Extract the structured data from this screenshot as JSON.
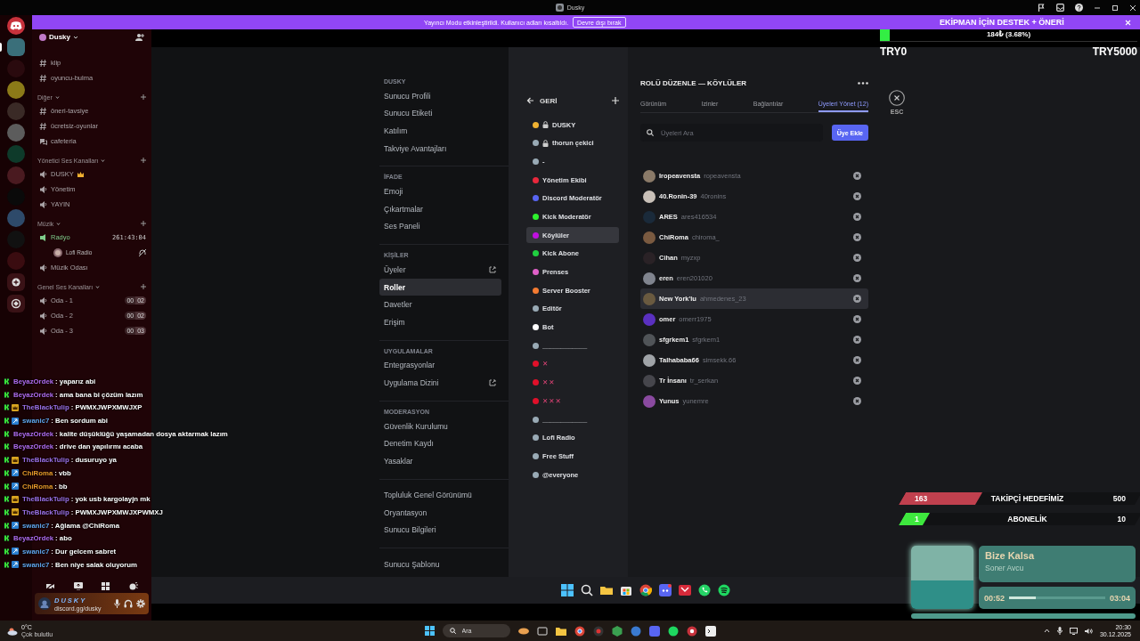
{
  "window": {
    "title": "Dusky"
  },
  "banner": {
    "message": "Yayıncı Modu etkinleştirildi. Kullanıcı adları kısaltıldı.",
    "button": "Devre dışı bırak",
    "promo": "EKİPMAN İÇİN DESTEK + ÖNERİ"
  },
  "rail": {
    "servers": [
      {
        "selected": true
      },
      {
        "selected": false
      },
      {
        "selected": false
      },
      {
        "selected": false
      },
      {
        "selected": false
      },
      {
        "selected": false
      },
      {
        "selected": false
      },
      {
        "selected": false
      },
      {
        "selected": false
      },
      {
        "selected": false
      },
      {
        "selected": false
      }
    ]
  },
  "server": {
    "name": "Dusky"
  },
  "channels": [
    {
      "kind": "text",
      "name": "klip"
    },
    {
      "kind": "text",
      "name": "oyuncu-bulma"
    },
    {
      "kind": "category",
      "name": "Diğer"
    },
    {
      "kind": "text",
      "name": "öneri-tavsiye"
    },
    {
      "kind": "text",
      "name": "ücretsiz-oyunlar"
    },
    {
      "kind": "forum",
      "name": "cafeteria"
    },
    {
      "kind": "category",
      "name": "Yönetici Ses Kanalları"
    },
    {
      "kind": "voice",
      "name": "DUSKY"
    },
    {
      "kind": "voice",
      "name": "Yönetim"
    },
    {
      "kind": "voice",
      "name": "YAYIN"
    },
    {
      "kind": "category",
      "name": "Müzik"
    },
    {
      "kind": "stage",
      "name": "Radyo",
      "time": "261:43:04"
    },
    {
      "kind": "member",
      "name": "Lofi Radio"
    },
    {
      "kind": "voice",
      "name": "Müzik Odası"
    },
    {
      "kind": "category",
      "name": "Genel Ses Kanalları"
    },
    {
      "kind": "voice",
      "name": "Oda - 1",
      "count": "00",
      "limit": "02"
    },
    {
      "kind": "voice",
      "name": "Oda - 2",
      "count": "00",
      "limit": "02"
    },
    {
      "kind": "voice",
      "name": "Oda - 3",
      "count": "00",
      "limit": "03"
    }
  ],
  "user_panel": {
    "name": "DUSKY",
    "status": "discord.gg/dusky"
  },
  "chat": [
    {
      "kind": "plain",
      "user": "BeyazOrdek",
      "color": "#b06cf0",
      "text": ": yaparız abi"
    },
    {
      "kind": "plain",
      "user": "BeyazOrdek",
      "color": "#b06cf0",
      "text": ": ama bana bi çözüm lazım"
    },
    {
      "kind": "crown",
      "user": "TheBlackTulip",
      "color": "#9d72ea",
      "text": ": PWMXJWPXMWJXP"
    },
    {
      "kind": "square",
      "user": "swanic7",
      "color": "#62a6ee",
      "text": ": Ben sordum abi"
    },
    {
      "kind": "plain",
      "user": "BeyazOrdek",
      "color": "#b06cf0",
      "text": ": kalite düşüklüğü yaşamadan dosya aktarmak lazım"
    },
    {
      "kind": "plain",
      "user": "BeyazOrdek",
      "color": "#b06cf0",
      "text": ": drive dan yapılırmı acaba"
    },
    {
      "kind": "crown",
      "user": "TheBlackTulip",
      "color": "#9d72ea",
      "text": ": dusuruyo ya"
    },
    {
      "kind": "square",
      "user": "ChiRoma",
      "color": "#e89a2a",
      "text": ": vbb"
    },
    {
      "kind": "square",
      "user": "ChiRoma",
      "color": "#e89a2a",
      "text": ": bb"
    },
    {
      "kind": "crown",
      "user": "TheBlackTulip",
      "color": "#9d72ea",
      "text": ": yok usb kargolayjn mk"
    },
    {
      "kind": "crown",
      "user": "TheBlackTulip",
      "color": "#9d72ea",
      "text": ": PWMXJWPXMWJXPWMXJ"
    },
    {
      "kind": "square",
      "user": "swanic7",
      "color": "#62a6ee",
      "text": ": Ağlama @ChiRoma"
    },
    {
      "kind": "plain",
      "user": "BeyazOrdek",
      "color": "#b06cf0",
      "text": ": abo"
    },
    {
      "kind": "square",
      "user": "swanic7",
      "color": "#62a6ee",
      "text": ": Dur gelcem sabret"
    },
    {
      "kind": "square",
      "user": "swanic7",
      "color": "#62a6ee",
      "text": ": Ben niye salak oluyorum"
    }
  ],
  "settings_nav": [
    {
      "title": "DUSKY",
      "items": [
        {
          "label": "Sunucu Profili",
          "selected": false,
          "external": false
        },
        {
          "label": "Sunucu Etiketi",
          "selected": false,
          "external": false
        },
        {
          "label": "Katılım",
          "selected": false,
          "external": false
        },
        {
          "label": "Takviye Avantajları",
          "selected": false,
          "external": false
        }
      ]
    },
    {
      "title": "İFADE",
      "items": [
        {
          "label": "Emoji",
          "selected": false,
          "external": false
        },
        {
          "label": "Çıkartmalar",
          "selected": false,
          "external": false
        },
        {
          "label": "Ses Paneli",
          "selected": false,
          "external": false
        }
      ]
    },
    {
      "title": "KİŞİLER",
      "items": [
        {
          "label": "Üyeler",
          "selected": false,
          "external": true
        },
        {
          "label": "Roller",
          "selected": true,
          "external": false
        },
        {
          "label": "Davetler",
          "selected": false,
          "external": false
        },
        {
          "label": "Erişim",
          "selected": false,
          "external": false
        }
      ]
    },
    {
      "title": "UYGULAMALAR",
      "items": [
        {
          "label": "Entegrasyonlar",
          "selected": false,
          "external": false
        },
        {
          "label": "Uygulama Dizini",
          "selected": false,
          "external": true
        }
      ]
    },
    {
      "title": "MODERASYON",
      "items": [
        {
          "label": "Güvenlik Kurulumu",
          "selected": false,
          "external": false
        },
        {
          "label": "Denetim Kaydı",
          "selected": false,
          "external": false
        },
        {
          "label": "Yasaklar",
          "selected": false,
          "external": false
        }
      ]
    },
    {
      "items": [
        {
          "label": "Topluluk Genel Görünümü",
          "selected": false,
          "external": false
        },
        {
          "label": "Oryantasyon",
          "selected": false,
          "external": false
        },
        {
          "label": "Sunucu Bilgileri",
          "selected": false,
          "external": false
        }
      ]
    },
    {
      "items": [
        {
          "label": "Sunucu Şablonu",
          "selected": false,
          "external": false
        }
      ]
    }
  ],
  "roles": {
    "back": "GERİ",
    "items": [
      {
        "kind": "name",
        "name": "DUSKY",
        "color": "#f0b232",
        "locked": true,
        "selected": false
      },
      {
        "kind": "name",
        "name": "thorun çekici",
        "color": "#99aab5",
        "locked": true,
        "selected": false
      },
      {
        "kind": "name",
        "name": "-",
        "color": "#99aab5",
        "locked": false,
        "selected": false
      },
      {
        "kind": "name",
        "name": "Yönetim Ekibi",
        "color": "#e8283c",
        "locked": false,
        "selected": false
      },
      {
        "kind": "name",
        "name": "Discord Moderatör",
        "color": "#5865f2",
        "locked": false,
        "selected": false
      },
      {
        "kind": "name",
        "name": "Kick Moderatör",
        "color": "#2ef02e",
        "locked": false,
        "selected": false
      },
      {
        "kind": "name",
        "name": "Köylüler",
        "color": "#c010e0",
        "locked": false,
        "selected": true
      },
      {
        "kind": "name",
        "name": "Kick Abone",
        "color": "#20d040",
        "locked": false,
        "selected": false
      },
      {
        "kind": "name",
        "name": "Prenses",
        "color": "#e060c8",
        "locked": false,
        "selected": false
      },
      {
        "kind": "name",
        "name": "Server Booster",
        "color": "#f47b32",
        "locked": false,
        "selected": false
      },
      {
        "kind": "name",
        "name": "Editör",
        "color": "#99aab5",
        "locked": false,
        "selected": false
      },
      {
        "kind": "name",
        "name": "Bot",
        "color": "#ffffff",
        "locked": false,
        "selected": false
      },
      {
        "kind": "name",
        "name": "____________",
        "color": "#99aab5",
        "locked": false,
        "selected": false
      },
      {
        "kind": "mark",
        "name": "✕",
        "color": "#e0102a",
        "locked": false,
        "selected": false
      },
      {
        "kind": "mark",
        "name": "✕✕",
        "color": "#e0102a",
        "locked": false,
        "selected": false
      },
      {
        "kind": "mark",
        "name": "✕✕✕",
        "color": "#e0102a",
        "locked": false,
        "selected": false
      },
      {
        "kind": "name",
        "name": "____________",
        "color": "#99aab5",
        "locked": false,
        "selected": false
      },
      {
        "kind": "name",
        "name": "Lofi Radio",
        "color": "#99aab5",
        "locked": false,
        "selected": false
      },
      {
        "kind": "name",
        "name": "Free Stuff",
        "color": "#99aab5",
        "locked": false,
        "selected": false
      },
      {
        "kind": "name",
        "name": "@everyone",
        "color": "#99aab5",
        "locked": false,
        "selected": false
      }
    ]
  },
  "editor": {
    "title": "ROLÜ DÜZENLE — KÖYLÜLER",
    "tabs": [
      {
        "label": "Görünüm",
        "selected": false
      },
      {
        "label": "Izinler",
        "selected": false
      },
      {
        "label": "Bağlantılar",
        "selected": false
      },
      {
        "label": "Üyeleri Yönet (12)",
        "selected": true
      }
    ],
    "close_label": "ESC",
    "search": {
      "placeholder": "Üyeleri Ara"
    },
    "add_button": "Üye Ekle",
    "members": [
      {
        "display": "Iropeavensta",
        "username": "ropeavensta",
        "hovered": false
      },
      {
        "display": "40.Ronin-39",
        "username": "40ronins",
        "hovered": false
      },
      {
        "display": "ARES",
        "username": "ares416534",
        "hovered": false
      },
      {
        "display": "ChiRoma",
        "username": "chiroma_",
        "hovered": false
      },
      {
        "display": "Cihan",
        "username": "myzxp",
        "hovered": false
      },
      {
        "display": "eren",
        "username": "eren201020",
        "hovered": false
      },
      {
        "display": "New York'lu",
        "username": "ahmedenes_23",
        "hovered": true
      },
      {
        "display": "omer",
        "username": "omerr1975",
        "hovered": false
      },
      {
        "display": "sfgrkem1",
        "username": "sfgrkem1",
        "hovered": false
      },
      {
        "display": "Talhababa66",
        "username": "simsekk.66",
        "hovered": false
      },
      {
        "display": "Tr İnsanı",
        "username": "tr_serkan",
        "hovered": false
      },
      {
        "display": "Yunus",
        "username": "yunemre",
        "hovered": false
      }
    ]
  },
  "donation": {
    "level": 0.0368,
    "amount": "184₺ (3.68%)",
    "min": "TRY0",
    "max": "TRY5000"
  },
  "goals": [
    {
      "current": "163",
      "title": "TAKİPÇİ HEDEFİMİZ",
      "target": "500",
      "level": 0.326,
      "color": "#c0404e"
    },
    {
      "current": "1",
      "title": "ABONELİK",
      "target": "10",
      "level": 0.1,
      "color": "#3ee83e"
    }
  ],
  "music": {
    "title": "Bize Kalsa",
    "artist": "Soner Avcu",
    "elapsed": "00:52",
    "duration": "03:04",
    "level": 0.28
  },
  "taskbar": {
    "temperature": "0°C",
    "condition": "Çok bulutlu",
    "search": {
      "placeholder": "Ara"
    },
    "time": "20:30",
    "date": "30.12.2025"
  }
}
